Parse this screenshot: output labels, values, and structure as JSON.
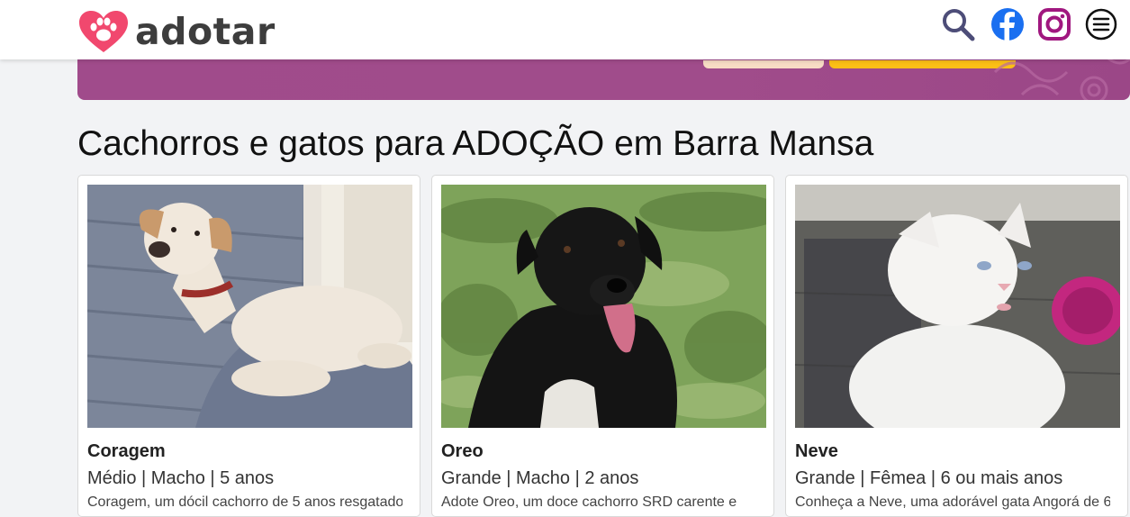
{
  "header": {
    "logo_text": "adotar",
    "icons": [
      "search-icon",
      "facebook-icon",
      "instagram-icon",
      "menu-icon"
    ],
    "colors": {
      "logo_heart": "#f1486e",
      "search": "#4d4d78",
      "facebook": "#1a6ff0",
      "instagram": "#a0177f"
    }
  },
  "banner": {
    "color": "#a04b8b",
    "button_1_color": "#f7dcc4",
    "button_2_color": "#fbbf16"
  },
  "main": {
    "title": "Cachorros e gatos para ADOÇÃO em Barra Mansa",
    "cards": [
      {
        "name": "Coragem",
        "info": "Médio | Macho | 5 anos",
        "description": "Coragem, um dócil cachorro de 5 anos resgatado",
        "photo": "dog-photo"
      },
      {
        "name": "Oreo",
        "info": "Grande | Macho | 2 anos",
        "description": "Adote Oreo, um doce cachorro SRD carente e",
        "photo": "dog-photo"
      },
      {
        "name": "Neve",
        "info": "Grande | Fêmea | 6 ou mais anos",
        "description": "Conheça a Neve, uma adorável gata Angorá de 6",
        "photo": "cat-photo"
      }
    ]
  }
}
